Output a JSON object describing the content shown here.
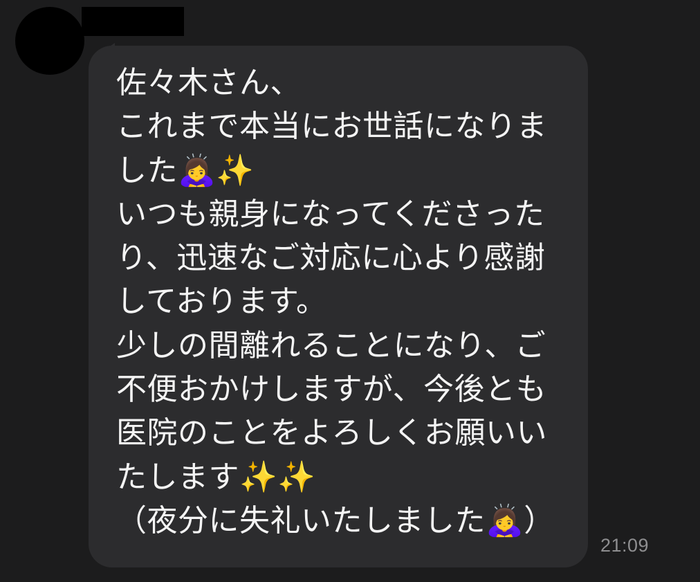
{
  "conversation": {
    "sender_name": "",
    "message_lines": [
      "佐々木さん、",
      "これまで本当にお世話になりま",
      "した🙇‍♀️✨",
      "いつも親身になってくださった",
      "り、迅速なご対応に心より感謝",
      "しております。",
      "少しの間離れることになり、ご",
      "不便おかけしますが、今後とも",
      "医院のことをよろしくお願いい",
      "たします✨✨",
      "（夜分に失礼いたしました🙇‍♀️）"
    ],
    "timestamp": "21:09"
  },
  "colors": {
    "background": "#1c1c1d",
    "bubble": "#2c2c2e",
    "text": "#f4f4f4",
    "timestamp": "#8e8e90"
  }
}
